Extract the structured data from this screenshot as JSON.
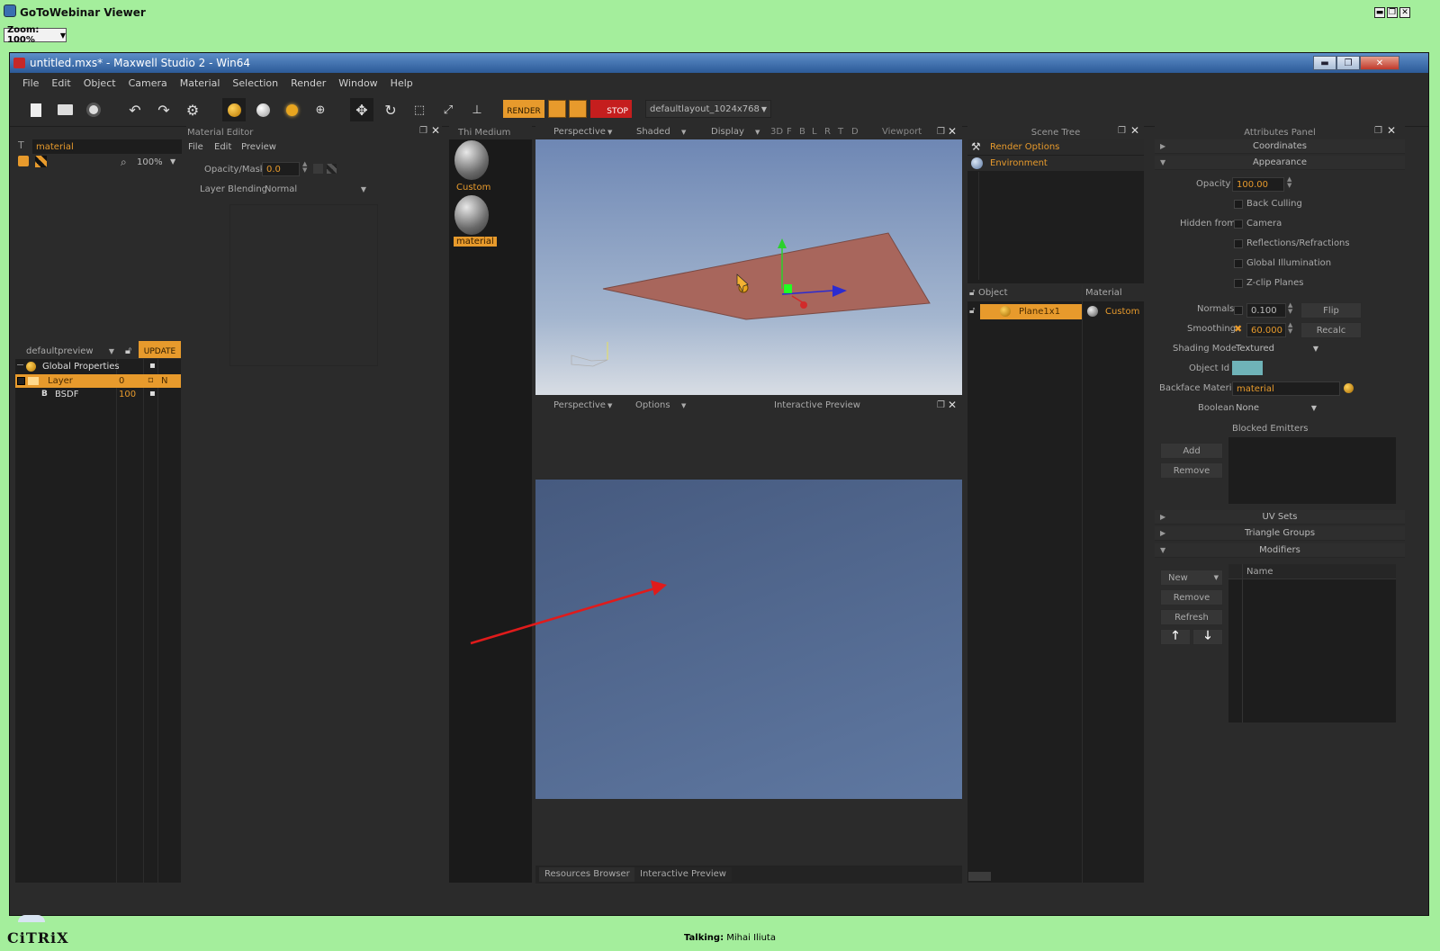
{
  "gtw": {
    "title": "GoToWebinar Viewer",
    "zoom": "Zoom: 100%",
    "talking_label": "Talking:",
    "talking_name": "Mihai Iliuta",
    "brand": "CiTRiX",
    "win_buttons": [
      "▬",
      "❐",
      "✕"
    ]
  },
  "maxwell": {
    "title": "untitled.mxs* - Maxwell Studio 2 -  Win64",
    "menu": [
      "File",
      "Edit",
      "Object",
      "Camera",
      "Material",
      "Selection",
      "Render",
      "Window",
      "Help"
    ],
    "toolbar": {
      "render_label": "RENDER",
      "stop_label": "STOP",
      "layout_value": "defaultlayout_1024x768"
    },
    "material_list": {
      "search_value": "material",
      "zoom_value": "100%",
      "preview_select": "defaultpreview",
      "update_label": "UPDATE",
      "tree": [
        {
          "name": "Global Properties",
          "val": "",
          "flag": "▪",
          "extra": ""
        },
        {
          "name": "Layer",
          "val": "0",
          "flag": "▫",
          "extra": "N"
        },
        {
          "name": "BSDF",
          "val": "100",
          "flag": "▪",
          "extra": "",
          "prefix": "B"
        }
      ]
    },
    "material_editor": {
      "title": "Material Editor",
      "menu": [
        "File",
        "Edit",
        "Preview"
      ],
      "opacity_label": "Opacity/Mask",
      "opacity_value": "0.0",
      "blending_label": "Layer Blending",
      "blending_value": "Normal"
    },
    "thumbs": {
      "title": "Thi Medium",
      "items": [
        "Custom",
        "material"
      ]
    },
    "viewport": {
      "camera": "Perspective",
      "shading": "Shaded",
      "display": "Display",
      "flags": [
        "3D",
        "F",
        "B",
        "L",
        "R",
        "T",
        "D"
      ],
      "title": "Viewport"
    },
    "interactive": {
      "camera": "Perspective",
      "options": "Options",
      "title": "Interactive Preview"
    },
    "bottom_tabs": [
      "Resources Browser",
      "Interactive Preview"
    ],
    "scene_tree": {
      "title": "Scene Tree",
      "items": [
        "Render Options",
        "Environment"
      ],
      "object_col": "Object",
      "material_col": "Material",
      "object_name": "Plane1x1",
      "object_material": "Custom"
    },
    "attributes": {
      "title": "Attributes Panel",
      "sections": [
        "Coordinates",
        "Appearance",
        "UV Sets",
        "Triangle Groups",
        "Modifiers"
      ],
      "opacity_label": "Opacity",
      "opacity_value": "100.00",
      "back_culling": "Back Culling",
      "hidden_from": "Hidden from",
      "hidden_options": [
        "Camera",
        "Reflections/Refractions",
        "Global Illumination",
        "Z-clip Planes"
      ],
      "normals_label": "Normals",
      "normals_value": "0.100",
      "flip_label": "Flip",
      "smoothing_label": "Smoothing",
      "smoothing_value": "60.000",
      "recalc_label": "Recalc",
      "shading_label": "Shading Mode",
      "shading_value": "Textured",
      "object_id_label": "Object Id",
      "object_id_color": "#6fb3b8",
      "backface_label": "Backface Material",
      "backface_value": "material",
      "boolean_label": "Boolean",
      "boolean_value": "None",
      "blocked_emitters": "Blocked Emitters",
      "add_label": "Add",
      "remove_label": "Remove",
      "mod_new": "New",
      "mod_remove": "Remove",
      "mod_refresh": "Refresh",
      "mod_name_col": "Name"
    }
  },
  "colors": {
    "accent": "#e79a2c",
    "frame_green": "#a4ee9c",
    "panel_bg": "#2b2b2b",
    "plane": "#a8665c"
  }
}
